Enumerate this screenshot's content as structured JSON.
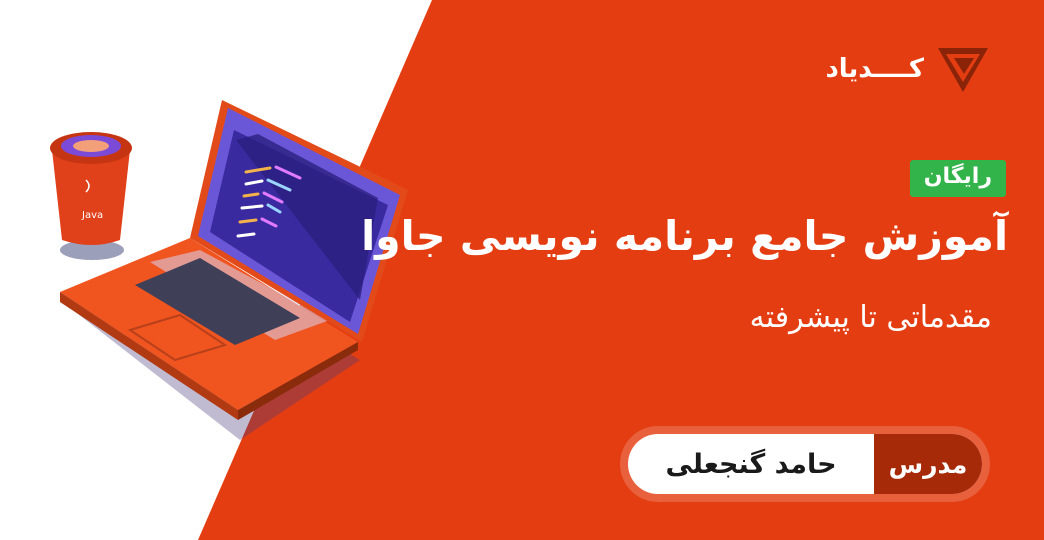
{
  "brand": {
    "name": "کــــدیاد",
    "logo_icon": "codeyad-logo-icon"
  },
  "badge": {
    "label": "رایگان"
  },
  "course": {
    "title": "آموزش جامع برنامه نویسی جاوا",
    "subtitle": "مقدماتی تا پیشرفته"
  },
  "instructor": {
    "role_label": "مدرس",
    "name": "حامد گنجعلی"
  },
  "illustration": {
    "cup_label": "Java",
    "laptop_icon": "laptop-code-icon",
    "cup_icon": "java-cup-icon"
  },
  "colors": {
    "accent": "#e43d12",
    "badge": "#33b44a",
    "role_bg": "#a62a07"
  }
}
